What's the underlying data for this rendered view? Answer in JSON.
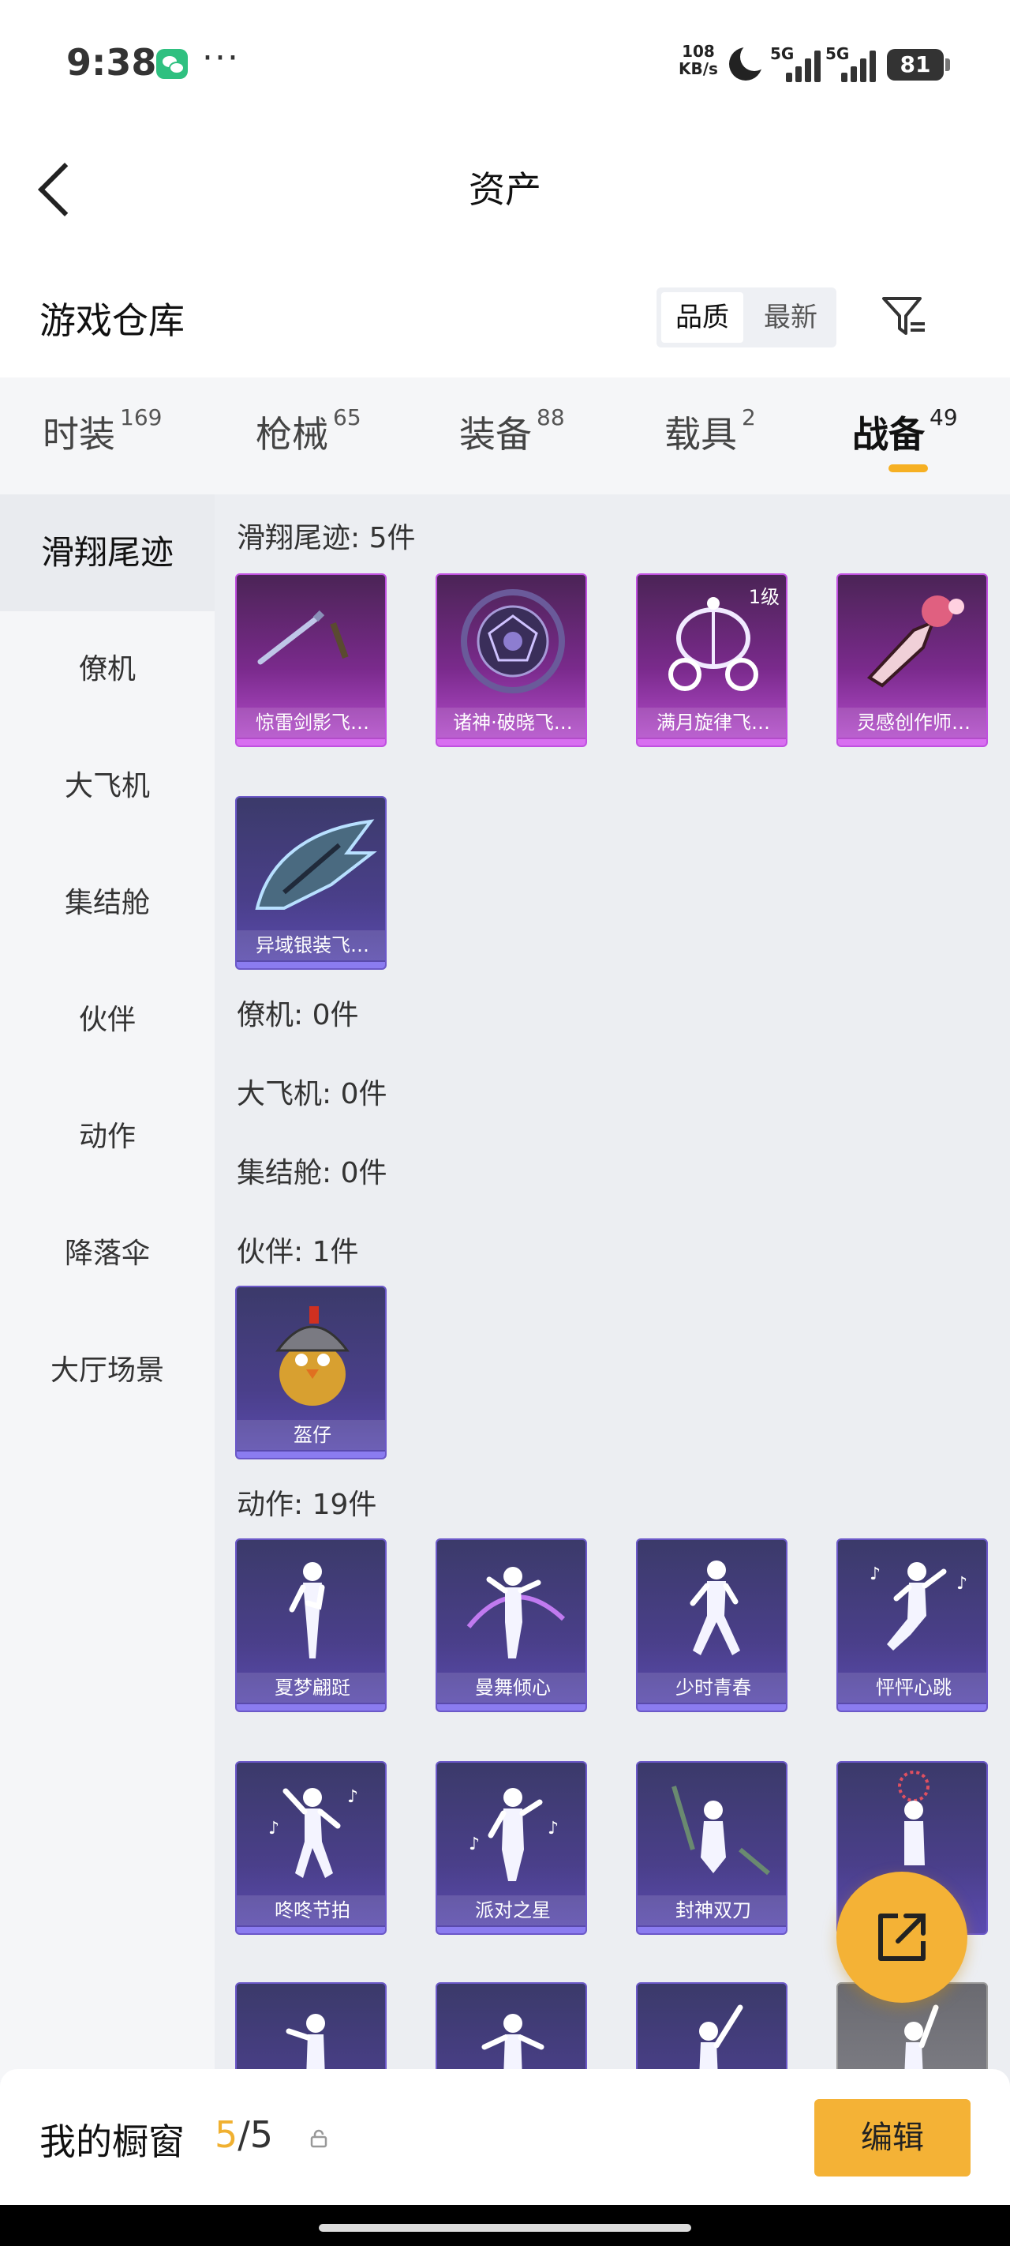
{
  "status": {
    "time": "9:38",
    "speed_top": "108",
    "speed_bottom": "KB/s",
    "net1": "5G",
    "net2": "5G",
    "battery": "81"
  },
  "header": {
    "title": "资产"
  },
  "warehouse": {
    "title": "游戏仓库",
    "sort_quality": "品质",
    "sort_latest": "最新"
  },
  "tabs": [
    {
      "label": "时装",
      "count": "169"
    },
    {
      "label": "枪械",
      "count": "65"
    },
    {
      "label": "装备",
      "count": "88"
    },
    {
      "label": "载具",
      "count": "2"
    },
    {
      "label": "战备",
      "count": "49"
    }
  ],
  "sidebar": [
    "滑翔尾迹",
    "僚机",
    "大飞机",
    "集结舱",
    "伙伴",
    "动作",
    "降落伞",
    "大厅场景"
  ],
  "sections": {
    "trail": "滑翔尾迹: 5件",
    "wingman": "僚机: 0件",
    "plane": "大飞机: 0件",
    "pod": "集结舱: 0件",
    "partner": "伙伴: 1件",
    "emote": "动作: 19件"
  },
  "trail_items": [
    "惊雷剑影飞…",
    "诸神·破晓飞…",
    "满月旋律飞…",
    "灵感创作师…",
    "异域银装飞…"
  ],
  "trail_level": "1级",
  "partner_items": [
    "盔仔"
  ],
  "emote_items": [
    "夏梦翩跹",
    "曼舞倾心",
    "少时青春",
    "怦怦心跳",
    "咚咚节拍",
    "派对之星",
    "封神双刀"
  ],
  "bottom": {
    "showcase": "我的橱窗",
    "current": "5",
    "total": "/5",
    "edit": "编辑"
  },
  "icons": [
    "back-icon",
    "wechat-icon",
    "moon-icon",
    "filter-icon",
    "share-icon",
    "lock-icon"
  ],
  "colors": {
    "accent": "#f4b236",
    "purple_card": "#7a2a8c",
    "blue_card": "#4a3f8a"
  }
}
